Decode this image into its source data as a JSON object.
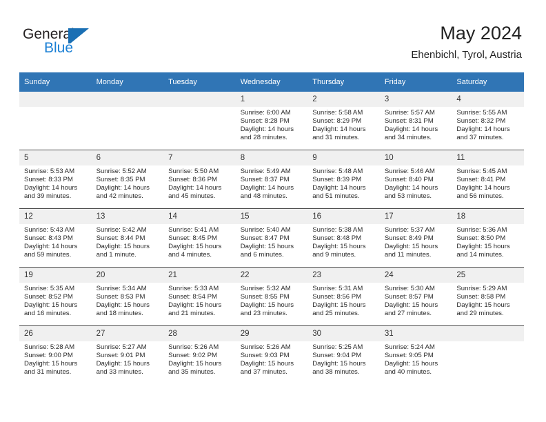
{
  "brand": {
    "name_part1": "General",
    "name_part2": "Blue",
    "accent_color": "#1a7fd4",
    "flag_color": "#1a6fb4",
    "icon": "general-blue-flag-logo"
  },
  "header": {
    "title": "May 2024",
    "subtitle": "Ehenbichl, Tyrol, Austria"
  },
  "theme": {
    "header_row_bg": "#3075b5",
    "daynum_bg": "#f0f0f0",
    "grid_line": "#4a4a4a",
    "text": "#2b2b2b"
  },
  "weekdays": [
    "Sunday",
    "Monday",
    "Tuesday",
    "Wednesday",
    "Thursday",
    "Friday",
    "Saturday"
  ],
  "labels": {
    "sunrise": "Sunrise:",
    "sunset": "Sunset:",
    "daylight": "Daylight:"
  },
  "weeks": [
    [
      {
        "day": "",
        "empty": true
      },
      {
        "day": "",
        "empty": true
      },
      {
        "day": "",
        "empty": true
      },
      {
        "day": "1",
        "sunrise": "Sunrise: 6:00 AM",
        "sunset": "Sunset: 8:28 PM",
        "daylight_line1": "Daylight: 14 hours",
        "daylight_line2": "and 28 minutes."
      },
      {
        "day": "2",
        "sunrise": "Sunrise: 5:58 AM",
        "sunset": "Sunset: 8:29 PM",
        "daylight_line1": "Daylight: 14 hours",
        "daylight_line2": "and 31 minutes."
      },
      {
        "day": "3",
        "sunrise": "Sunrise: 5:57 AM",
        "sunset": "Sunset: 8:31 PM",
        "daylight_line1": "Daylight: 14 hours",
        "daylight_line2": "and 34 minutes."
      },
      {
        "day": "4",
        "sunrise": "Sunrise: 5:55 AM",
        "sunset": "Sunset: 8:32 PM",
        "daylight_line1": "Daylight: 14 hours",
        "daylight_line2": "and 37 minutes."
      }
    ],
    [
      {
        "day": "5",
        "sunrise": "Sunrise: 5:53 AM",
        "sunset": "Sunset: 8:33 PM",
        "daylight_line1": "Daylight: 14 hours",
        "daylight_line2": "and 39 minutes."
      },
      {
        "day": "6",
        "sunrise": "Sunrise: 5:52 AM",
        "sunset": "Sunset: 8:35 PM",
        "daylight_line1": "Daylight: 14 hours",
        "daylight_line2": "and 42 minutes."
      },
      {
        "day": "7",
        "sunrise": "Sunrise: 5:50 AM",
        "sunset": "Sunset: 8:36 PM",
        "daylight_line1": "Daylight: 14 hours",
        "daylight_line2": "and 45 minutes."
      },
      {
        "day": "8",
        "sunrise": "Sunrise: 5:49 AM",
        "sunset": "Sunset: 8:37 PM",
        "daylight_line1": "Daylight: 14 hours",
        "daylight_line2": "and 48 minutes."
      },
      {
        "day": "9",
        "sunrise": "Sunrise: 5:48 AM",
        "sunset": "Sunset: 8:39 PM",
        "daylight_line1": "Daylight: 14 hours",
        "daylight_line2": "and 51 minutes."
      },
      {
        "day": "10",
        "sunrise": "Sunrise: 5:46 AM",
        "sunset": "Sunset: 8:40 PM",
        "daylight_line1": "Daylight: 14 hours",
        "daylight_line2": "and 53 minutes."
      },
      {
        "day": "11",
        "sunrise": "Sunrise: 5:45 AM",
        "sunset": "Sunset: 8:41 PM",
        "daylight_line1": "Daylight: 14 hours",
        "daylight_line2": "and 56 minutes."
      }
    ],
    [
      {
        "day": "12",
        "sunrise": "Sunrise: 5:43 AM",
        "sunset": "Sunset: 8:43 PM",
        "daylight_line1": "Daylight: 14 hours",
        "daylight_line2": "and 59 minutes."
      },
      {
        "day": "13",
        "sunrise": "Sunrise: 5:42 AM",
        "sunset": "Sunset: 8:44 PM",
        "daylight_line1": "Daylight: 15 hours",
        "daylight_line2": "and 1 minute."
      },
      {
        "day": "14",
        "sunrise": "Sunrise: 5:41 AM",
        "sunset": "Sunset: 8:45 PM",
        "daylight_line1": "Daylight: 15 hours",
        "daylight_line2": "and 4 minutes."
      },
      {
        "day": "15",
        "sunrise": "Sunrise: 5:40 AM",
        "sunset": "Sunset: 8:47 PM",
        "daylight_line1": "Daylight: 15 hours",
        "daylight_line2": "and 6 minutes."
      },
      {
        "day": "16",
        "sunrise": "Sunrise: 5:38 AM",
        "sunset": "Sunset: 8:48 PM",
        "daylight_line1": "Daylight: 15 hours",
        "daylight_line2": "and 9 minutes."
      },
      {
        "day": "17",
        "sunrise": "Sunrise: 5:37 AM",
        "sunset": "Sunset: 8:49 PM",
        "daylight_line1": "Daylight: 15 hours",
        "daylight_line2": "and 11 minutes."
      },
      {
        "day": "18",
        "sunrise": "Sunrise: 5:36 AM",
        "sunset": "Sunset: 8:50 PM",
        "daylight_line1": "Daylight: 15 hours",
        "daylight_line2": "and 14 minutes."
      }
    ],
    [
      {
        "day": "19",
        "sunrise": "Sunrise: 5:35 AM",
        "sunset": "Sunset: 8:52 PM",
        "daylight_line1": "Daylight: 15 hours",
        "daylight_line2": "and 16 minutes."
      },
      {
        "day": "20",
        "sunrise": "Sunrise: 5:34 AM",
        "sunset": "Sunset: 8:53 PM",
        "daylight_line1": "Daylight: 15 hours",
        "daylight_line2": "and 18 minutes."
      },
      {
        "day": "21",
        "sunrise": "Sunrise: 5:33 AM",
        "sunset": "Sunset: 8:54 PM",
        "daylight_line1": "Daylight: 15 hours",
        "daylight_line2": "and 21 minutes."
      },
      {
        "day": "22",
        "sunrise": "Sunrise: 5:32 AM",
        "sunset": "Sunset: 8:55 PM",
        "daylight_line1": "Daylight: 15 hours",
        "daylight_line2": "and 23 minutes."
      },
      {
        "day": "23",
        "sunrise": "Sunrise: 5:31 AM",
        "sunset": "Sunset: 8:56 PM",
        "daylight_line1": "Daylight: 15 hours",
        "daylight_line2": "and 25 minutes."
      },
      {
        "day": "24",
        "sunrise": "Sunrise: 5:30 AM",
        "sunset": "Sunset: 8:57 PM",
        "daylight_line1": "Daylight: 15 hours",
        "daylight_line2": "and 27 minutes."
      },
      {
        "day": "25",
        "sunrise": "Sunrise: 5:29 AM",
        "sunset": "Sunset: 8:58 PM",
        "daylight_line1": "Daylight: 15 hours",
        "daylight_line2": "and 29 minutes."
      }
    ],
    [
      {
        "day": "26",
        "sunrise": "Sunrise: 5:28 AM",
        "sunset": "Sunset: 9:00 PM",
        "daylight_line1": "Daylight: 15 hours",
        "daylight_line2": "and 31 minutes."
      },
      {
        "day": "27",
        "sunrise": "Sunrise: 5:27 AM",
        "sunset": "Sunset: 9:01 PM",
        "daylight_line1": "Daylight: 15 hours",
        "daylight_line2": "and 33 minutes."
      },
      {
        "day": "28",
        "sunrise": "Sunrise: 5:26 AM",
        "sunset": "Sunset: 9:02 PM",
        "daylight_line1": "Daylight: 15 hours",
        "daylight_line2": "and 35 minutes."
      },
      {
        "day": "29",
        "sunrise": "Sunrise: 5:26 AM",
        "sunset": "Sunset: 9:03 PM",
        "daylight_line1": "Daylight: 15 hours",
        "daylight_line2": "and 37 minutes."
      },
      {
        "day": "30",
        "sunrise": "Sunrise: 5:25 AM",
        "sunset": "Sunset: 9:04 PM",
        "daylight_line1": "Daylight: 15 hours",
        "daylight_line2": "and 38 minutes."
      },
      {
        "day": "31",
        "sunrise": "Sunrise: 5:24 AM",
        "sunset": "Sunset: 9:05 PM",
        "daylight_line1": "Daylight: 15 hours",
        "daylight_line2": "and 40 minutes."
      },
      {
        "day": "",
        "empty": true
      }
    ]
  ]
}
